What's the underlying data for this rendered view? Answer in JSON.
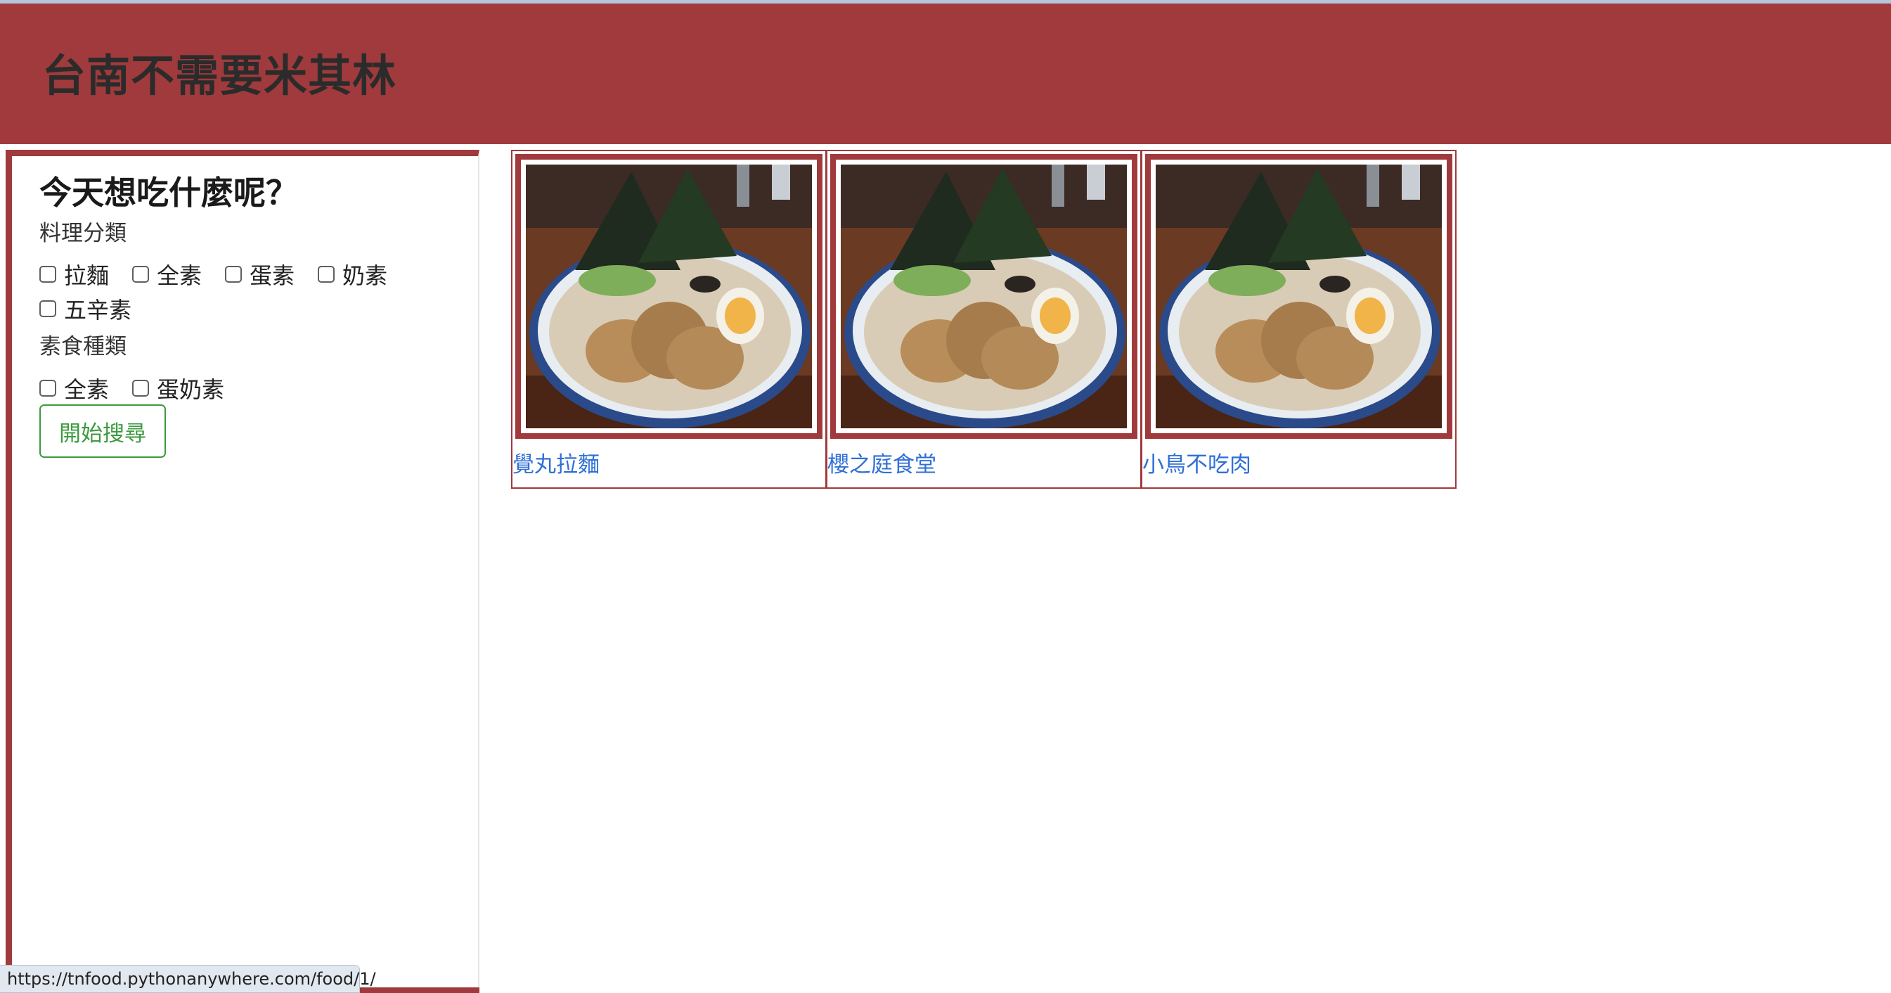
{
  "header": {
    "title": "台南不需要米其林"
  },
  "sidebar": {
    "heading": "今天想吃什麼呢？",
    "cuisine_group": {
      "label": "料理分類",
      "options": [
        "拉麵",
        "全素",
        "蛋素",
        "奶素",
        "五辛素"
      ]
    },
    "veg_group": {
      "label": "素食種類",
      "options": [
        "全素",
        "蛋奶素"
      ]
    },
    "search_button": "開始搜尋"
  },
  "restaurants": [
    {
      "name": "覺丸拉麵",
      "image": "ramen-bowl-photo"
    },
    {
      "name": "櫻之庭食堂",
      "image": "ramen-bowl-photo"
    },
    {
      "name": "小鳥不吃肉",
      "image": "ramen-bowl-photo"
    }
  ],
  "status_bar": {
    "url": "https://tnfood.pythonanywhere.com/food/1/"
  },
  "colors": {
    "brand": "#a03a3c",
    "link": "#2f6fd6",
    "button": "#3c9a3e"
  }
}
